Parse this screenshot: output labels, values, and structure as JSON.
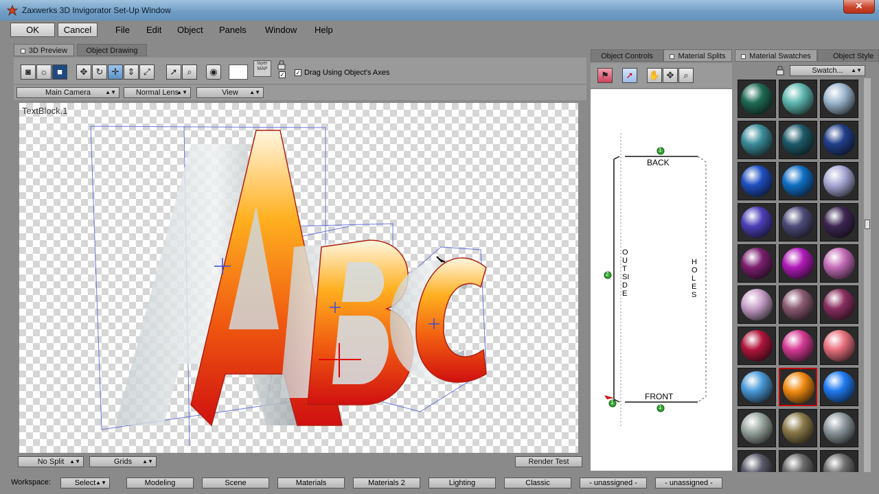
{
  "window": {
    "title": "Zaxwerks 3D Invigorator Set-Up Window",
    "close_glyph": "✕"
  },
  "menubar": {
    "ok_label": "OK",
    "cancel_label": "Cancel",
    "items": [
      "File",
      "Edit",
      "Object",
      "Panels",
      "Window",
      "Help"
    ]
  },
  "preview": {
    "tabs": [
      "3D Preview",
      "Object Drawing"
    ],
    "active_tab": "3D Preview",
    "layer_map_label": "layer MAP",
    "drag_axes_label": "Drag Using Object's Axes",
    "drag_axes_checked": true,
    "camera": "Main Camera",
    "lens": "Normal Lens",
    "view": "View",
    "object_label": "TextBlock.1",
    "letters": [
      "A",
      "B",
      "C"
    ],
    "split": "No Split",
    "grids": "Grids",
    "render_test": "Render Test"
  },
  "object_panel": {
    "tabs": [
      "Object Controls",
      "Material Splits"
    ],
    "active_tab": "Material Splits",
    "split_diagram": {
      "back": "BACK",
      "front": "FRONT",
      "outside": "OUTSIDE",
      "holes": "HOLES",
      "marker_1": "1",
      "marker_2": "2"
    }
  },
  "materials_panel": {
    "tabs": [
      "Material Swatches",
      "Object Style"
    ],
    "active_tab": "Material Swatches",
    "swatch_dropdown": "Swatch...",
    "swatches": [
      {
        "color": "#1f6b55"
      },
      {
        "color": "#5fb7b0"
      },
      {
        "color": "#9db8cf"
      },
      {
        "color": "#3b8d9a"
      },
      {
        "color": "#1d5a68"
      },
      {
        "color": "#213f8a"
      },
      {
        "color": "#1f4fc2"
      },
      {
        "color": "#0f6fc4"
      },
      {
        "color": "#a8a8d6"
      },
      {
        "color": "#4c3fb8"
      },
      {
        "color": "#4d4b78"
      },
      {
        "color": "#3d2652"
      },
      {
        "color": "#7b1f6f"
      },
      {
        "color": "#b01ab8"
      },
      {
        "color": "#c46cb8"
      },
      {
        "color": "#c8a0c8"
      },
      {
        "color": "#8a5a72"
      },
      {
        "color": "#8a2f60"
      },
      {
        "color": "#b0153c"
      },
      {
        "color": "#d63a94"
      },
      {
        "color": "#e8707e"
      },
      {
        "color": "#4a9ad8"
      },
      {
        "color": "#f08a10"
      },
      {
        "color": "#1f7af0"
      },
      {
        "color": "#9aa6a0"
      },
      {
        "color": "#8a7a4a"
      },
      {
        "color": "#8e989e"
      },
      {
        "color": "#5a5a6a"
      },
      {
        "color": "#6a6a6a"
      },
      {
        "color": "#6f6f6f"
      }
    ],
    "selected_index": 22
  },
  "workspace": {
    "label": "Workspace:",
    "select": "Select",
    "buttons": [
      "Modeling",
      "Scene",
      "Materials",
      "Materials 2",
      "Lighting",
      "Classic",
      "- unassigned -",
      "- unassigned -"
    ]
  }
}
